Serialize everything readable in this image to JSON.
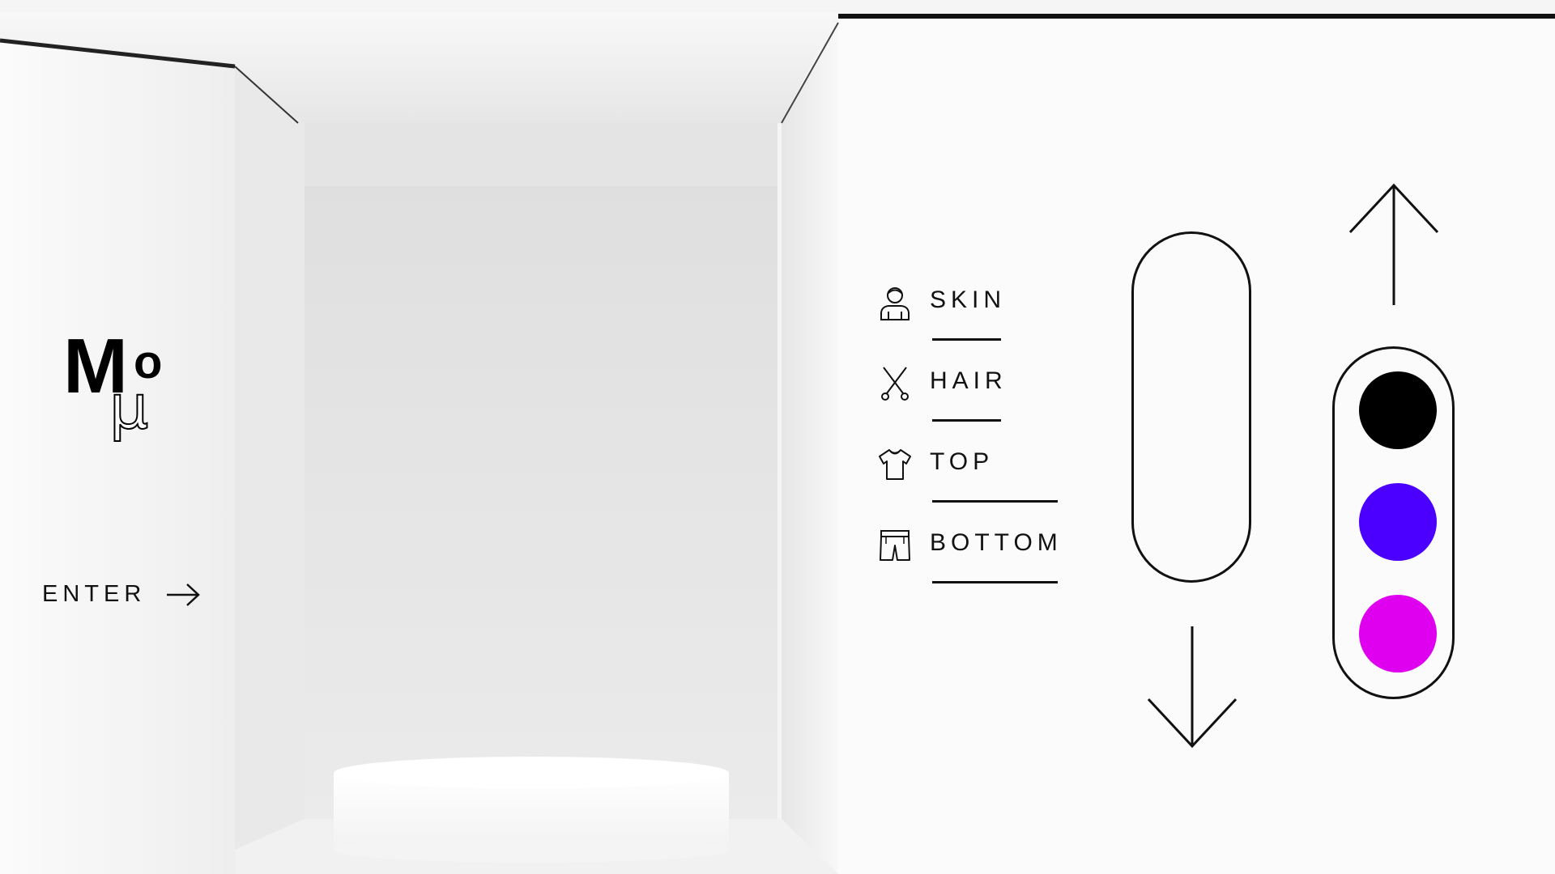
{
  "logo": {
    "letter_m": "M",
    "letter_o": "o",
    "letter_mu": "μ"
  },
  "enter": {
    "label": "ENTER",
    "icon": "arrow-right-icon"
  },
  "menu": {
    "items": [
      {
        "label": "SKIN",
        "icon": "person-icon"
      },
      {
        "label": "HAIR",
        "icon": "scissors-icon"
      },
      {
        "label": "TOP",
        "icon": "tshirt-icon"
      },
      {
        "label": "BOTTOM",
        "icon": "shorts-icon"
      }
    ]
  },
  "slider": {
    "up_icon": "arrow-up-icon",
    "down_icon": "arrow-down-icon"
  },
  "colors": {
    "swatches": [
      "#000000",
      "#4b00ff",
      "#e000f0"
    ]
  }
}
